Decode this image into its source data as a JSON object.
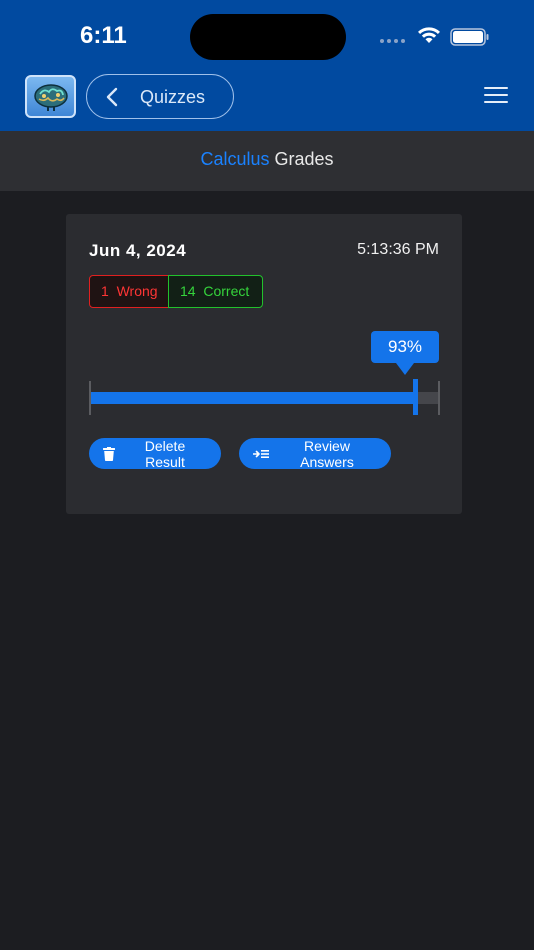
{
  "status_bar": {
    "time": "6:11"
  },
  "nav": {
    "back_label": "Quizzes"
  },
  "subheader": {
    "subject": "Calculus",
    "title_suffix": "Grades",
    "subject_color": "#1a82ff"
  },
  "result": {
    "date": "Jun 4, 2024",
    "time": "5:13:36 PM",
    "wrong_label": "1  Wrong",
    "correct_label": "14  Correct",
    "score_label": "93%",
    "score_fraction": 0.93,
    "delete_label": "Delete Result",
    "review_label": "Review Answers"
  },
  "colors": {
    "header_bg": "#014aa0",
    "accent": "#1474ea",
    "wrong": "#ff3535",
    "correct": "#35d43c"
  },
  "icons": {
    "app_logo": "brain-icon",
    "back": "chevron-left-icon",
    "menu": "hamburger-menu-icon",
    "delete": "trash-icon",
    "review": "review-list-icon"
  }
}
